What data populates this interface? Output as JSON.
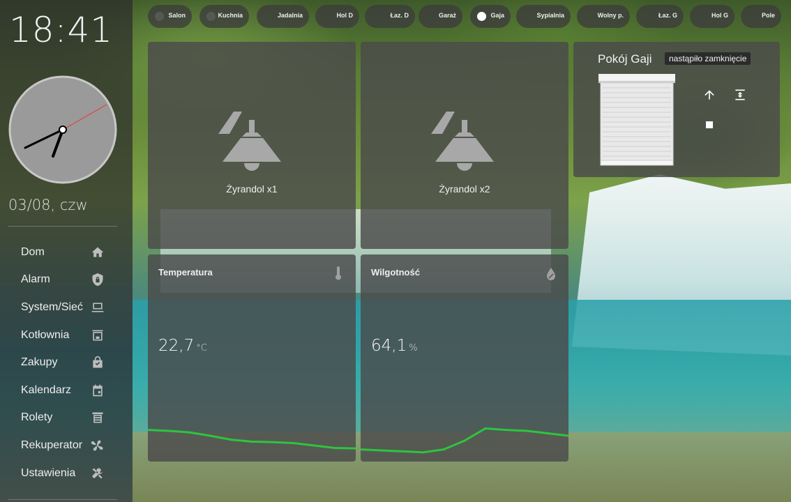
{
  "sidebar": {
    "time": "18:41",
    "date": "03/08, czw",
    "nav": [
      {
        "label": "Dom",
        "icon": "home-icon"
      },
      {
        "label": "Alarm",
        "icon": "shield-lock-icon"
      },
      {
        "label": "System/Sieć",
        "icon": "monitor-icon"
      },
      {
        "label": "Kotłownia",
        "icon": "furnace-icon"
      },
      {
        "label": "Zakupy",
        "icon": "shopping-bag-icon"
      },
      {
        "label": "Kalendarz",
        "icon": "calendar-icon"
      },
      {
        "label": "Rolety",
        "icon": "blinds-icon"
      },
      {
        "label": "Rekuperator",
        "icon": "fan-icon"
      },
      {
        "label": "Ustawienia",
        "icon": "tools-icon"
      }
    ]
  },
  "rooms": [
    {
      "label": "Salon",
      "active": false
    },
    {
      "label": "Kuchnia",
      "active": false
    },
    {
      "label": "Jadalnia",
      "active": false
    },
    {
      "label": "Hol D",
      "active": false
    },
    {
      "label": "Łaz. D",
      "active": false
    },
    {
      "label": "Garaż",
      "active": false
    },
    {
      "label": "Gaja",
      "active": true
    },
    {
      "label": "Sypialnia",
      "active": false
    },
    {
      "label": "Wolny p.",
      "active": false
    },
    {
      "label": "Łaz. G",
      "active": false
    },
    {
      "label": "Hol G",
      "active": false
    },
    {
      "label": "Pole",
      "active": false
    }
  ],
  "lights": [
    {
      "name": "Żyrandol x1",
      "icon": "ceiling-light-icon",
      "state": "off"
    },
    {
      "name": "Żyrandol x2",
      "icon": "ceiling-light-icon",
      "state": "off"
    }
  ],
  "sensors": [
    {
      "title": "Temperatura",
      "value": "22,7",
      "unit": "°C",
      "icon": "thermometer-icon",
      "history": [
        0.62,
        0.6,
        0.57,
        0.5,
        0.42,
        0.38,
        0.37,
        0.35,
        0.3,
        0.25,
        0.24
      ]
    },
    {
      "title": "Wilgotność",
      "value": "64,1",
      "unit": "%",
      "icon": "water-percent-icon",
      "history": [
        0.22,
        0.2,
        0.18,
        0.16,
        0.22,
        0.4,
        0.65,
        0.62,
        0.6,
        0.55,
        0.5
      ]
    }
  ],
  "cover": {
    "title": "Pokój Gaji",
    "state": "nastąpiło zamknięcie",
    "buttons": [
      "open-up-icon",
      "open-tilt-icon",
      "stop-icon"
    ]
  },
  "colors": {
    "graph_line": "#2ec43f",
    "card_bg": "#4b4b4b",
    "second_hand": "#e0463c"
  }
}
